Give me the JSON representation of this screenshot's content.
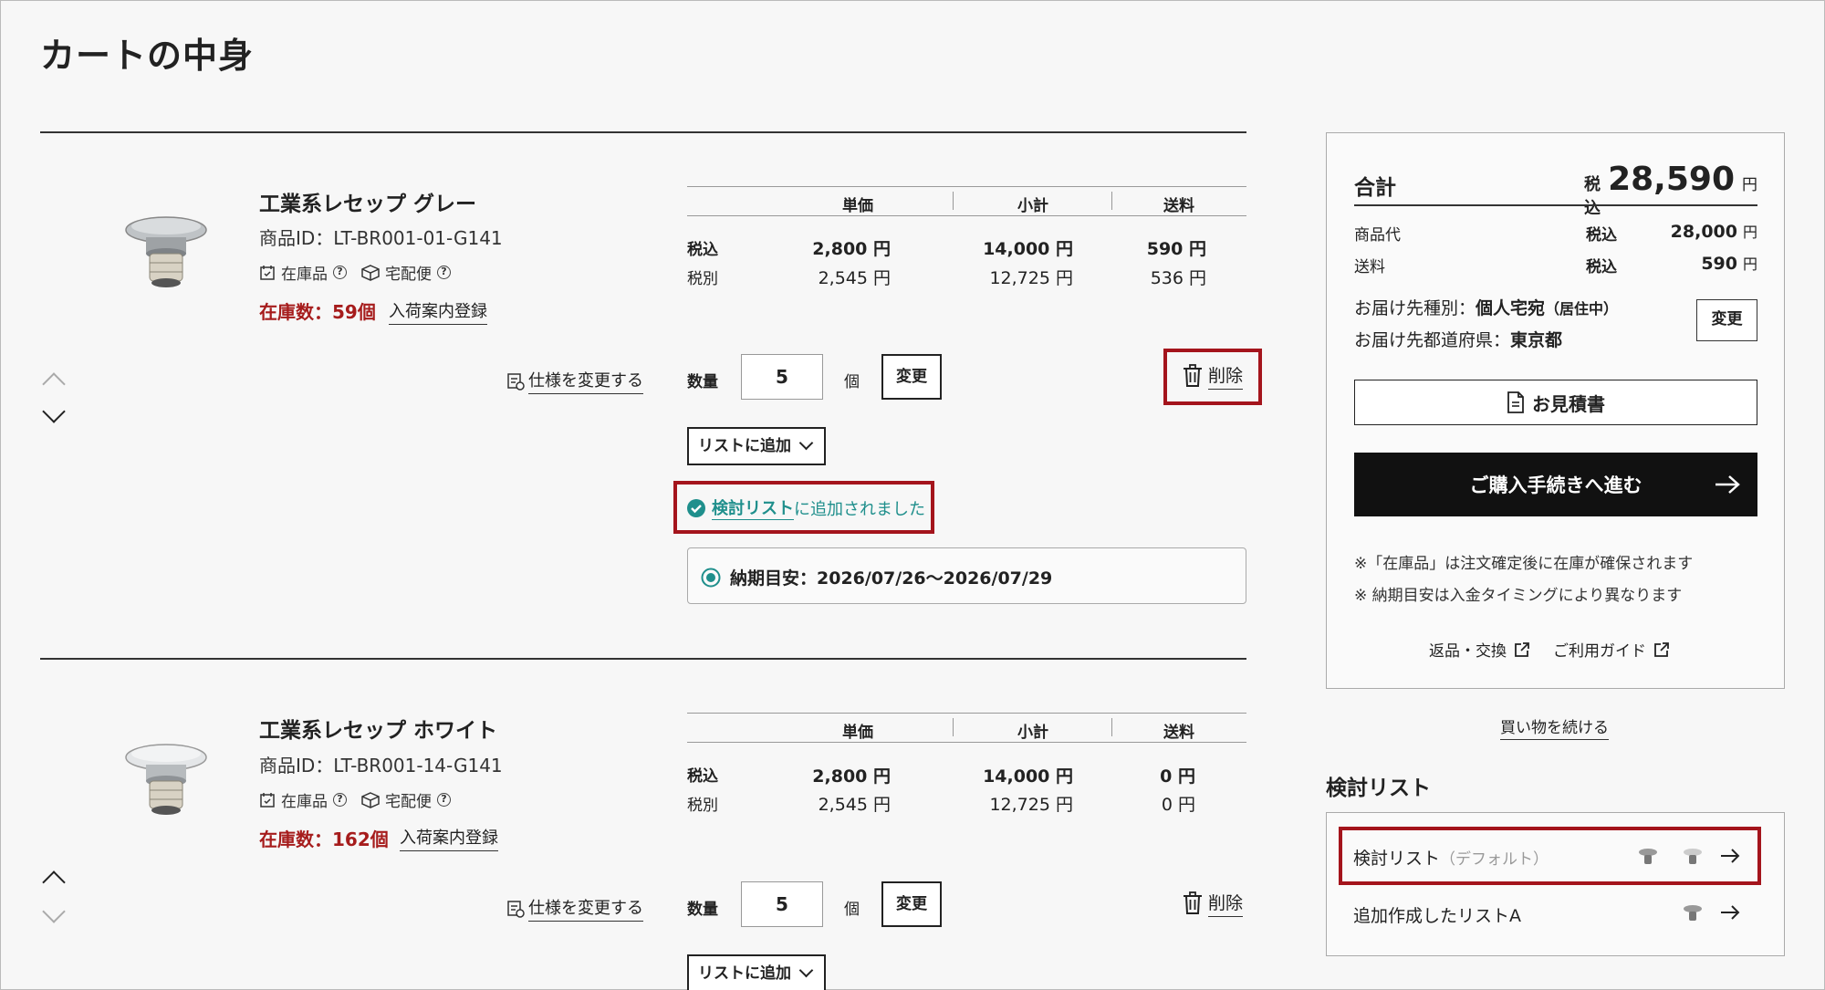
{
  "page": {
    "title": "カートの中身"
  },
  "items": [
    {
      "name": "工業系レセップ グレー",
      "product_id": "商品ID：LT-BR001-01-G141",
      "in_stock_label": "在庫品",
      "delivery_label": "宅配便",
      "stock_count": "在庫数：59個",
      "arrival_notice": "入荷案内登録",
      "change_spec": "仕様を変更する",
      "price_headers": [
        "単価",
        "小計",
        "送料"
      ],
      "tax_in_label": "税込",
      "tax_ex_label": "税別",
      "unit_in": "2,800 円",
      "sub_in": "14,000 円",
      "ship_in": "590 円",
      "unit_ex": "2,545 円",
      "sub_ex": "12,725 円",
      "ship_ex": "536 円",
      "qty_label": "数量",
      "qty": "5",
      "qty_unit": "個",
      "change_btn": "変更",
      "delete": "削除",
      "add_to_list": "リストに追加",
      "added_list_name": "検討リスト",
      "added_msg": "に追加されました",
      "delivery_estimate": "納期目安：2026/07/26〜2026/07/29"
    },
    {
      "name": "工業系レセップ ホワイト",
      "product_id": "商品ID：LT-BR001-14-G141",
      "in_stock_label": "在庫品",
      "delivery_label": "宅配便",
      "stock_count": "在庫数：162個",
      "arrival_notice": "入荷案内登録",
      "change_spec": "仕様を変更する",
      "price_headers": [
        "単価",
        "小計",
        "送料"
      ],
      "tax_in_label": "税込",
      "tax_ex_label": "税別",
      "unit_in": "2,800 円",
      "sub_in": "14,000 円",
      "ship_in": "0 円",
      "unit_ex": "2,545 円",
      "sub_ex": "12,725 円",
      "ship_ex": "0 円",
      "qty_label": "数量",
      "qty": "5",
      "qty_unit": "個",
      "change_btn": "変更",
      "delete": "削除",
      "add_to_list": "リストに追加"
    }
  ],
  "summary": {
    "total_label": "合計",
    "tax_in": "税込",
    "total_value": "28,590",
    "yen": "円",
    "goods_label": "商品代",
    "goods_value": "28,000",
    "shipping_label": "送料",
    "shipping_value": "590",
    "dest_type_label": "お届け先種別：",
    "dest_type_value": "個人宅宛",
    "dest_type_note": "（居住中）",
    "prefecture_label": "お届け先都道府県：",
    "prefecture_value": "東京都",
    "change_btn": "変更",
    "estimate_btn": "お見積書",
    "checkout_btn": "ご購入手続きへ進む",
    "note1": "※「在庫品」は注文確定後に在庫が確保されます",
    "note2": "※ 納期目安は入金タイミングにより異なります",
    "returns_link": "返品・交換",
    "guide_link": "ご利用ガイド",
    "continue_shopping": "買い物を続ける"
  },
  "wishlist": {
    "heading": "検討リスト",
    "lists": [
      {
        "name": "検討リスト",
        "note": "（デフォルト）"
      },
      {
        "name": "追加作成したリストA",
        "note": ""
      }
    ]
  },
  "colors": {
    "accent_red": "#a4141c",
    "stock_red": "#a61c1c",
    "teal": "#1f8f8c",
    "dark_button": "#111111"
  }
}
